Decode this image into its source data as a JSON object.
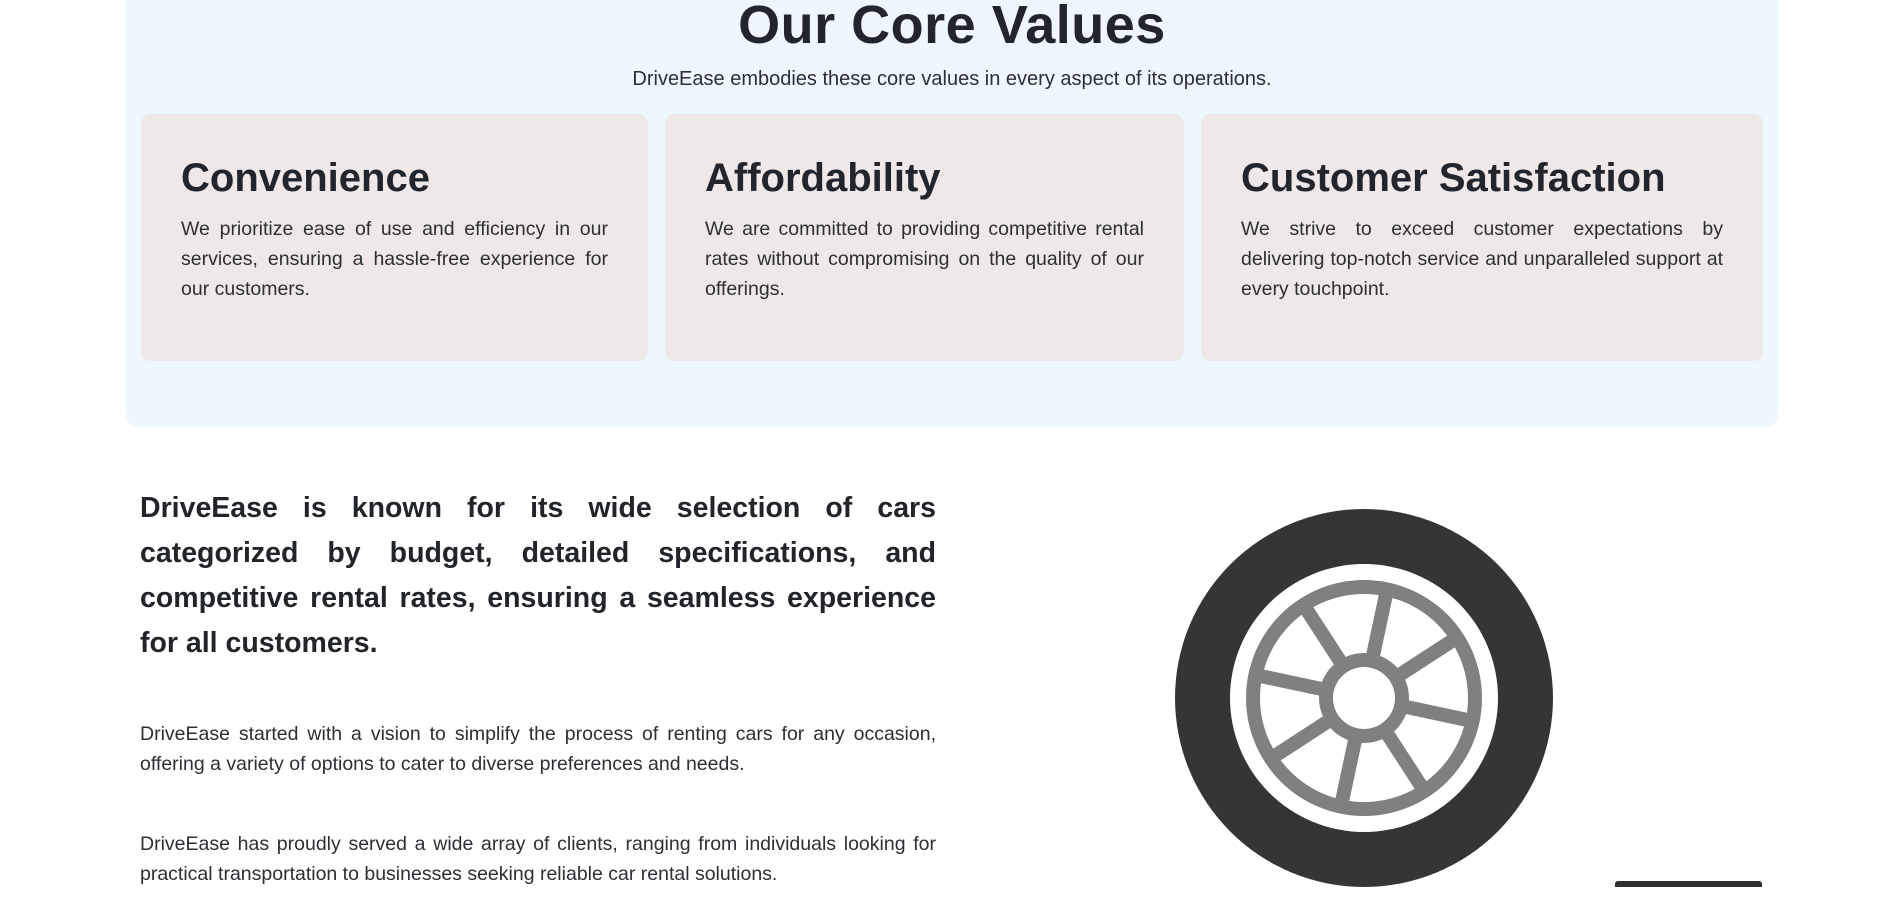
{
  "core_values": {
    "title": "Our Core Values",
    "subtitle": "DriveEase embodies these core values in every aspect of its operations.",
    "cards": [
      {
        "title": "Convenience",
        "text": "We prioritize ease of use and efficiency in our services, ensuring a hassle-free experience for our customers."
      },
      {
        "title": "Affordability",
        "text": "We are committed to providing competitive rental rates without compromising on the quality of our offerings."
      },
      {
        "title": "Customer Satisfaction",
        "text": "We strive to exceed customer expectations by delivering top-notch service and unparalleled support at every touchpoint."
      }
    ]
  },
  "about": {
    "lead": "DriveEase is known for its wide selection of cars categorized by budget, detailed specifications, and competitive rental rates, ensuring a seamless experience for all customers.",
    "paragraphs": [
      "DriveEase started with a vision to simplify the process of renting cars for any occasion, offering a variety of options to cater to diverse preferences and needs.",
      "DriveEase has proudly served a wide array of clients, ranging from individuals looking for practical transportation to businesses seeking reliable car rental solutions."
    ],
    "illustration_icon": "tire-icon"
  },
  "colors": {
    "section_bg": "#eef6fe",
    "card_bg": "#efe8e8",
    "tire_dark": "#353535",
    "tire_spokes": "#808080"
  }
}
